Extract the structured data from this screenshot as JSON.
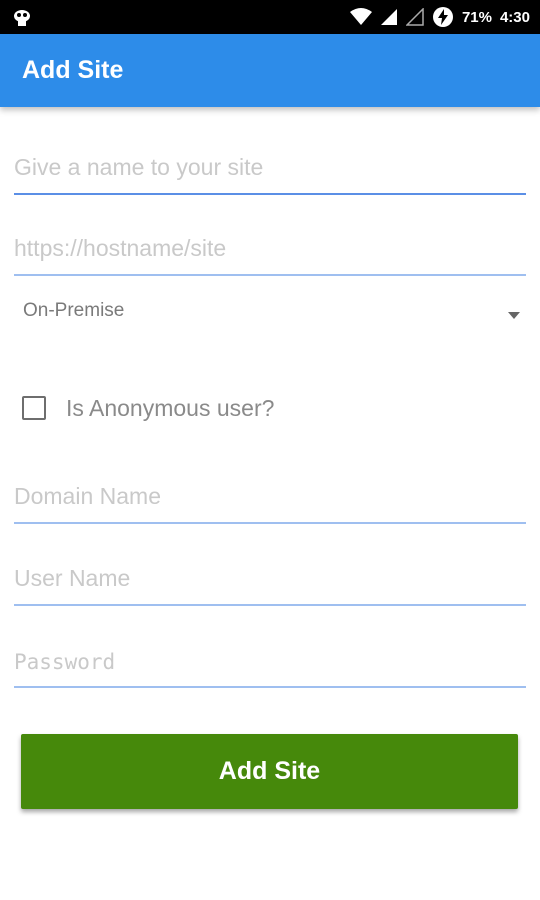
{
  "status_bar": {
    "battery": "71%",
    "time": "4:30",
    "icons": [
      "android-notification-icon",
      "wifi-icon",
      "cell-signal-icon",
      "no-signal-icon",
      "battery-charging-icon"
    ]
  },
  "app_bar": {
    "title": "Add Site",
    "color": "#2d8ce9"
  },
  "form": {
    "site_name": {
      "value": "",
      "placeholder": "Give a name to your site"
    },
    "site_url": {
      "value": "",
      "placeholder": "https://hostname/site"
    },
    "site_type": {
      "selected": "On-Premise"
    },
    "anonymous": {
      "label": "Is Anonymous user?",
      "checked": false
    },
    "domain": {
      "value": "",
      "placeholder": "Domain Name"
    },
    "username": {
      "value": "",
      "placeholder": "User Name"
    },
    "password": {
      "value": "",
      "placeholder": "Password"
    },
    "submit_label": "Add Site",
    "submit_color": "#46890b"
  }
}
